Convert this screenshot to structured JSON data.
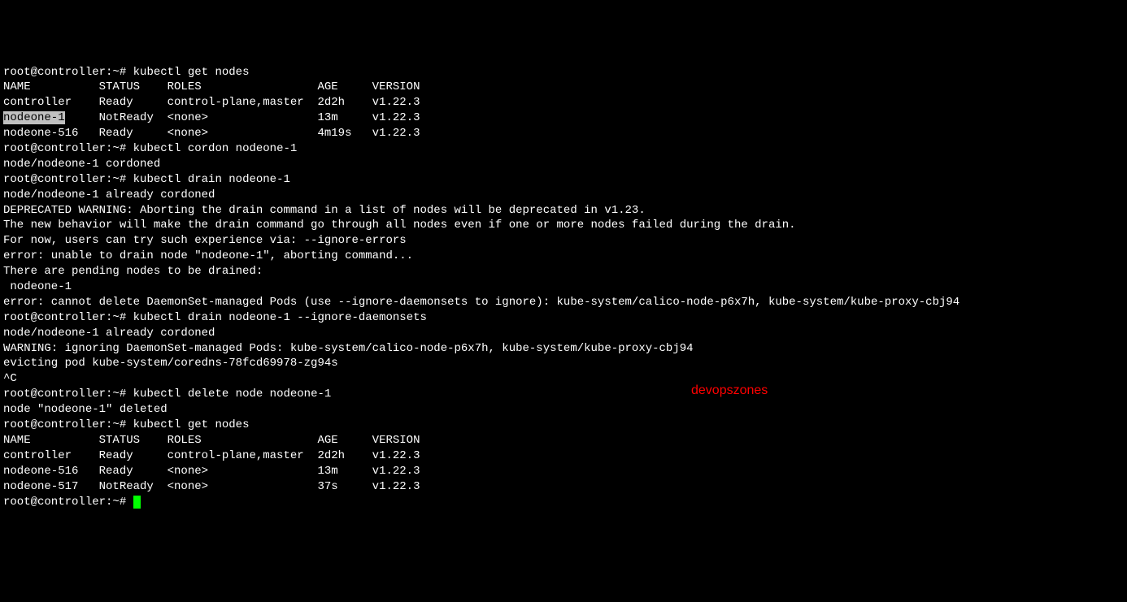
{
  "prompt": "root@controller:~#",
  "cmd1": "kubectl get nodes",
  "table1": {
    "header": {
      "name": "NAME",
      "status": "STATUS",
      "roles": "ROLES",
      "age": "AGE",
      "version": "VERSION"
    },
    "rows": [
      {
        "name": "controller",
        "status": "Ready",
        "roles": "control-plane,master",
        "age": "2d2h",
        "version": "v1.22.3"
      },
      {
        "name": "nodeone-1",
        "status": "NotReady",
        "roles": "<none>",
        "age": "13m",
        "version": "v1.22.3"
      },
      {
        "name": "nodeone-516",
        "status": "Ready",
        "roles": "<none>",
        "age": "4m19s",
        "version": "v1.22.3"
      }
    ]
  },
  "cmd2": "kubectl cordon nodeone-1",
  "out2": "node/nodeone-1 cordoned",
  "cmd3": "kubectl drain nodeone-1",
  "out3a": "node/nodeone-1 already cordoned",
  "out3b": "DEPRECATED WARNING: Aborting the drain command in a list of nodes will be deprecated in v1.23.",
  "out3c": "The new behavior will make the drain command go through all nodes even if one or more nodes failed during the drain.",
  "out3d": "For now, users can try such experience via: --ignore-errors",
  "out3e": "error: unable to drain node \"nodeone-1\", aborting command...",
  "out3f": "",
  "out3g": "There are pending nodes to be drained:",
  "out3h": " nodeone-1",
  "out3i": "error: cannot delete DaemonSet-managed Pods (use --ignore-daemonsets to ignore): kube-system/calico-node-p6x7h, kube-system/kube-proxy-cbj94",
  "cmd4": "kubectl drain nodeone-1 --ignore-daemonsets",
  "out4a": "node/nodeone-1 already cordoned",
  "out4b": "WARNING: ignoring DaemonSet-managed Pods: kube-system/calico-node-p6x7h, kube-system/kube-proxy-cbj94",
  "out4c": "evicting pod kube-system/coredns-78fcd69978-zg94s",
  "out4d": "",
  "out4e": "^C",
  "cmd5": "kubectl delete node nodeone-1",
  "out5": "node \"nodeone-1\" deleted",
  "cmd6": "kubectl get nodes",
  "table2": {
    "header": {
      "name": "NAME",
      "status": "STATUS",
      "roles": "ROLES",
      "age": "AGE",
      "version": "VERSION"
    },
    "rows": [
      {
        "name": "controller",
        "status": "Ready",
        "roles": "control-plane,master",
        "age": "2d2h",
        "version": "v1.22.3"
      },
      {
        "name": "nodeone-516",
        "status": "Ready",
        "roles": "<none>",
        "age": "13m",
        "version": "v1.22.3"
      },
      {
        "name": "nodeone-517",
        "status": "NotReady",
        "roles": "<none>",
        "age": "37s",
        "version": "v1.22.3"
      }
    ]
  },
  "watermark": "devopszones",
  "cols": {
    "name": 14,
    "status": 10,
    "roles": 22,
    "age": 8,
    "version": 10
  }
}
